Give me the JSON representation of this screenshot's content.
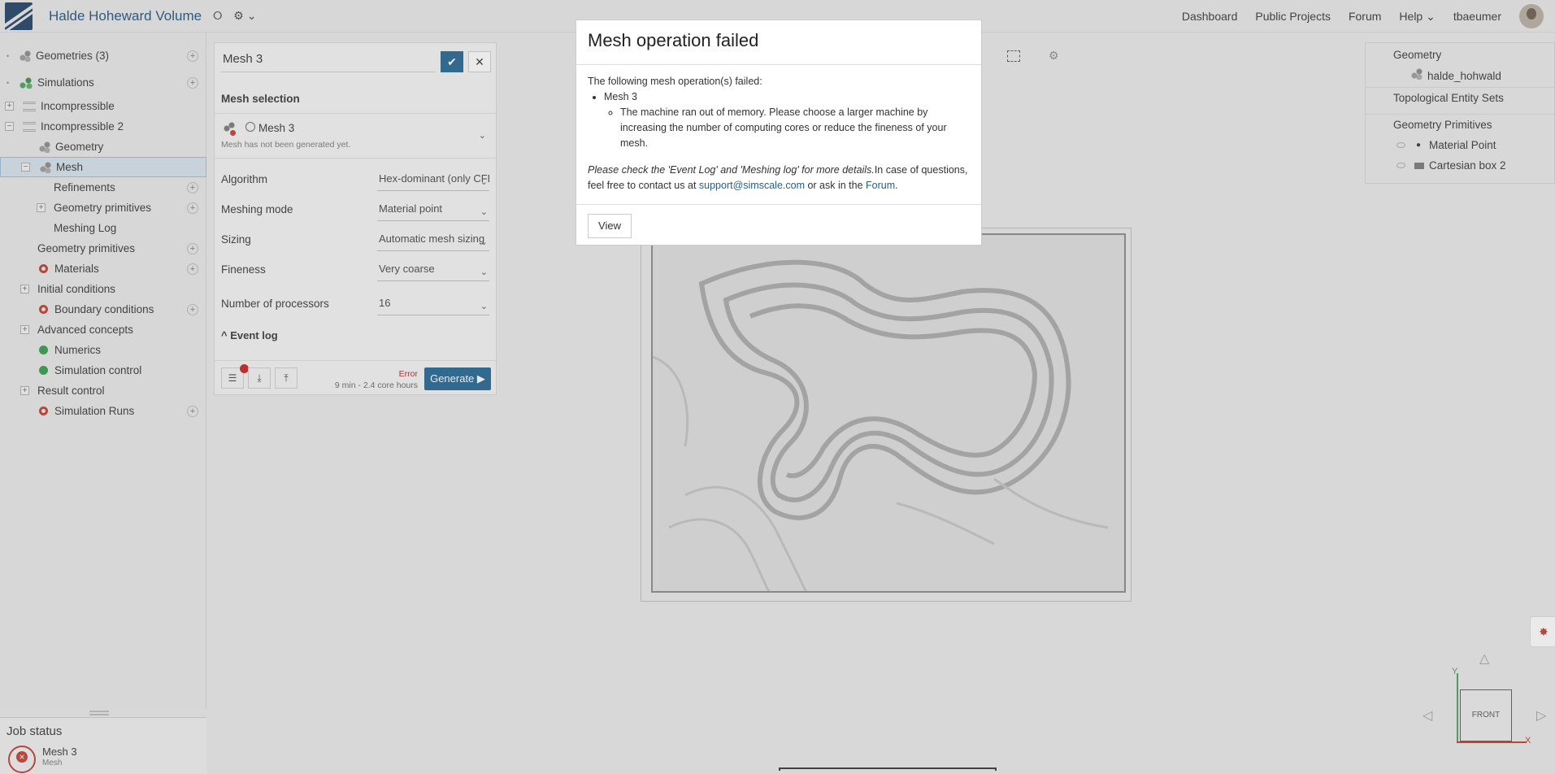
{
  "header": {
    "project_title": "Halde Hoheward Volume",
    "nav": [
      "Dashboard",
      "Public Projects",
      "Forum",
      "Help"
    ],
    "username": "tbaeumer"
  },
  "tree": {
    "geometries": "Geometries (3)",
    "simulations": "Simulations",
    "incompressible": "Incompressible",
    "incompressible2": "Incompressible 2",
    "geometry": "Geometry",
    "mesh": "Mesh",
    "refinements": "Refinements",
    "geometry_primitives_sub": "Geometry primitives",
    "meshing_log": "Meshing Log",
    "geometry_primitives": "Geometry primitives",
    "materials": "Materials",
    "initial_conditions": "Initial conditions",
    "boundary_conditions": "Boundary conditions",
    "advanced_concepts": "Advanced concepts",
    "numerics": "Numerics",
    "simulation_control": "Simulation control",
    "result_control": "Result control",
    "simulation_runs": "Simulation Runs"
  },
  "job_status": {
    "title": "Job status",
    "job_name": "Mesh 3",
    "job_sub": "Mesh"
  },
  "mesh_panel": {
    "name": "Mesh 3",
    "selection_label": "Mesh selection",
    "selected_mesh": "Mesh 3",
    "selected_sub": "Mesh has not been generated yet.",
    "fields": [
      {
        "label": "Algorithm",
        "value": "Hex-dominant (only CFD)"
      },
      {
        "label": "Meshing mode",
        "value": "Material point"
      },
      {
        "label": "Sizing",
        "value": "Automatic mesh sizing"
      },
      {
        "label": "Fineness",
        "value": "Very coarse"
      },
      {
        "label": "Number of processors",
        "value": "16"
      }
    ],
    "event_log": "Event log",
    "status": "Error",
    "time": "9 min - 2.4 core hours",
    "generate": "Generate"
  },
  "right_panel": {
    "geometry_head": "Geometry",
    "geometry_item": "halde_hohwald",
    "topo_head": "Topological Entity Sets",
    "prim_head": "Geometry Primitives",
    "prim_items": [
      "Material Point",
      "Cartesian box 2"
    ]
  },
  "nav_cube": {
    "face": "FRONT",
    "y": "Y",
    "x": "X"
  },
  "modal": {
    "title": "Mesh operation failed",
    "intro": "The following mesh operation(s) failed:",
    "failed_item": "Mesh 3",
    "reason": "The machine ran out of memory. Please choose a larger machine by increasing the number of computing cores or reduce the fineness of your mesh.",
    "note_italic": "Please check the 'Event Log' and 'Meshing log' for more details.",
    "note_rest": "In case of questions, feel free to contact us at ",
    "email": "support@simscale.com",
    "or_ask": " or ask in the ",
    "forum": "Forum",
    "end": ".",
    "view_button": "View"
  },
  "colors": {
    "brand": "#1e6291",
    "error": "#c0392b",
    "ok": "#2e9a46"
  }
}
